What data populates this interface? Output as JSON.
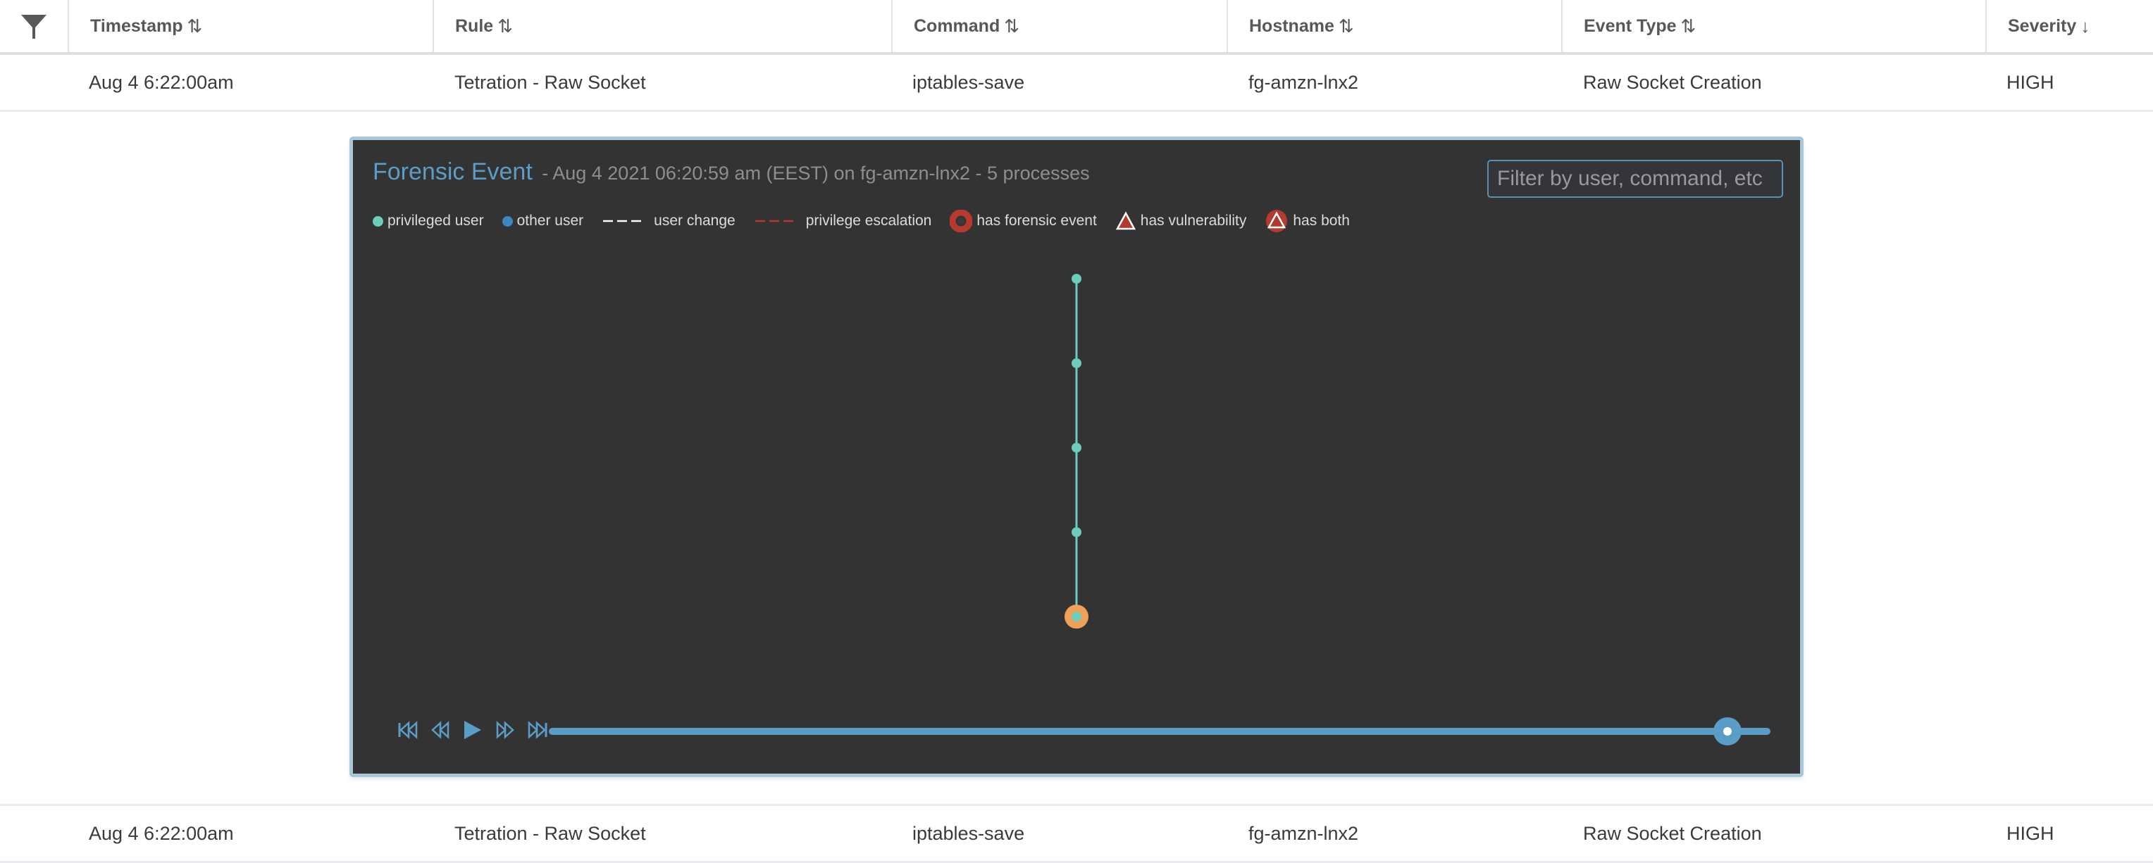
{
  "table": {
    "filter_icon": "filter-funnel-icon",
    "columns": [
      {
        "label": "Timestamp",
        "sort": "⇅",
        "sort_state": "unsorted"
      },
      {
        "label": "Rule",
        "sort": "⇅",
        "sort_state": "unsorted"
      },
      {
        "label": "Command",
        "sort": "⇅",
        "sort_state": "unsorted"
      },
      {
        "label": "Hostname",
        "sort": "⇅",
        "sort_state": "unsorted"
      },
      {
        "label": "Event Type",
        "sort": "⇅",
        "sort_state": "unsorted"
      },
      {
        "label": "Severity",
        "sort": "↓",
        "sort_state": "descending"
      }
    ],
    "rows": [
      {
        "timestamp": "Aug 4 6:22:00am",
        "rule": "Tetration - Raw Socket",
        "command": "iptables-save",
        "hostname": "fg-amzn-lnx2",
        "event_type": "Raw Socket Creation",
        "severity": "HIGH"
      },
      {
        "timestamp": "Aug 4 6:22:00am",
        "rule": "Tetration - Raw Socket",
        "command": "iptables-save",
        "hostname": "fg-amzn-lnx2",
        "event_type": "Raw Socket Creation",
        "severity": "HIGH"
      }
    ]
  },
  "forensic_panel": {
    "title": "Forensic Event",
    "subtitle": "- Aug 4 2021 06:20:59 am (EEST) on fg-amzn-lnx2 - 5 processes",
    "filter_placeholder": "Filter by user, command, etc",
    "filter_value": "",
    "legend": [
      {
        "label": "privileged user",
        "icon": "teal-dot-icon"
      },
      {
        "label": "other user",
        "icon": "blue-dot-icon"
      },
      {
        "label": "user change",
        "icon": "white-dashed-line-icon"
      },
      {
        "label": "privilege escalation",
        "icon": "red-dashed-line-icon"
      },
      {
        "label": "has forensic event",
        "icon": "red-ring-icon"
      },
      {
        "label": "has vulnerability",
        "icon": "red-triangle-icon"
      },
      {
        "label": "has both",
        "icon": "ring-triangle-icon"
      }
    ],
    "process_tree": {
      "nodes": [
        {
          "index": 1,
          "user_type": "privileged",
          "forensic_event": false,
          "selected": false
        },
        {
          "index": 2,
          "user_type": "privileged",
          "forensic_event": false,
          "selected": false
        },
        {
          "index": 3,
          "user_type": "privileged",
          "forensic_event": false,
          "selected": false
        },
        {
          "index": 4,
          "user_type": "privileged",
          "forensic_event": false,
          "selected": false
        },
        {
          "index": 5,
          "user_type": "privileged",
          "forensic_event": false,
          "selected": true
        }
      ],
      "edges": [
        [
          1,
          2
        ],
        [
          2,
          3
        ],
        [
          3,
          4
        ],
        [
          4,
          5
        ]
      ]
    },
    "playback": {
      "buttons": [
        "skip-to-start",
        "step-back",
        "play",
        "step-forward",
        "skip-to-end"
      ],
      "progress": 0.965
    },
    "colors": {
      "accent": "#5a9dc7",
      "privileged_user": "#6ccdb9",
      "other_user": "#3e86bf",
      "escalation": "#c0392b",
      "selected_ring": "#f0a05a",
      "panel_bg": "#333333"
    }
  }
}
